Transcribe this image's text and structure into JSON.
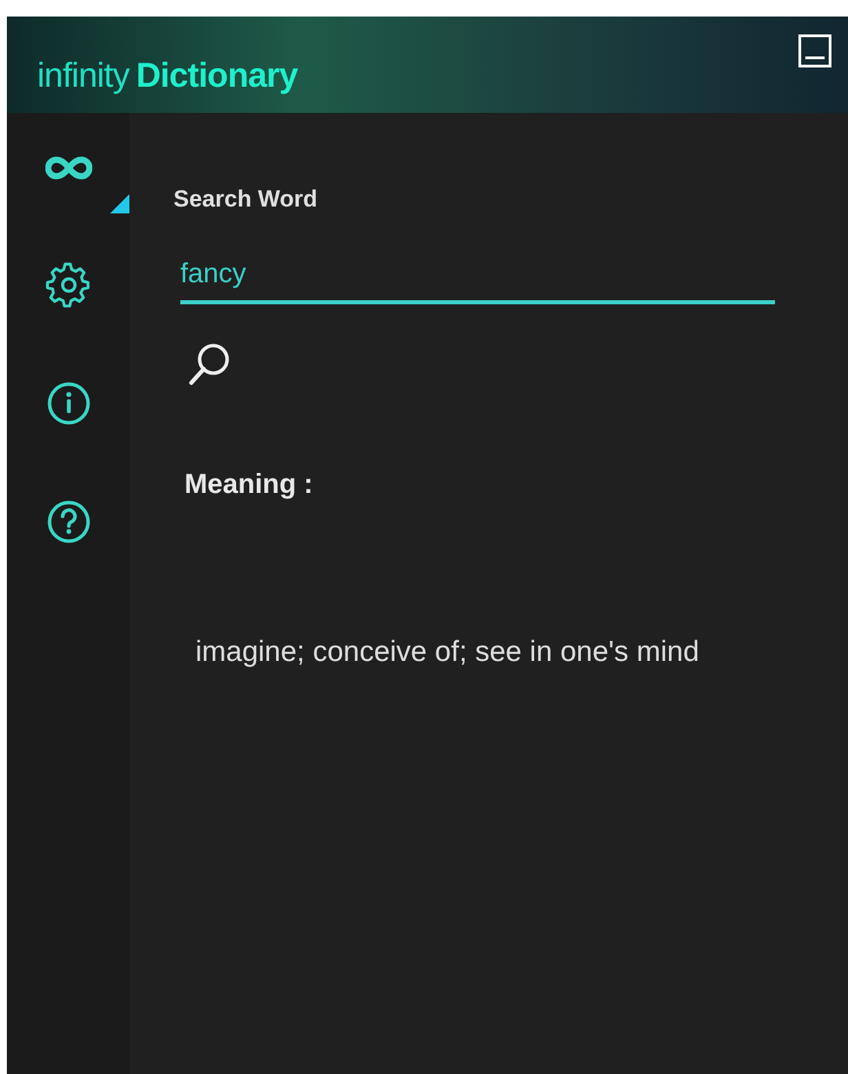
{
  "window": {
    "title_light": "infinity",
    "title_bold": "Dictionary"
  },
  "sidebar": {
    "items": [
      {
        "kind": "home",
        "selected": true
      },
      {
        "kind": "settings",
        "selected": false
      },
      {
        "kind": "info",
        "selected": false
      },
      {
        "kind": "help",
        "selected": false
      }
    ]
  },
  "search": {
    "label": "Search Word",
    "value": "fancy"
  },
  "meaning": {
    "label": "Meaning :",
    "text": "imagine; conceive of; see in one's mind"
  }
}
